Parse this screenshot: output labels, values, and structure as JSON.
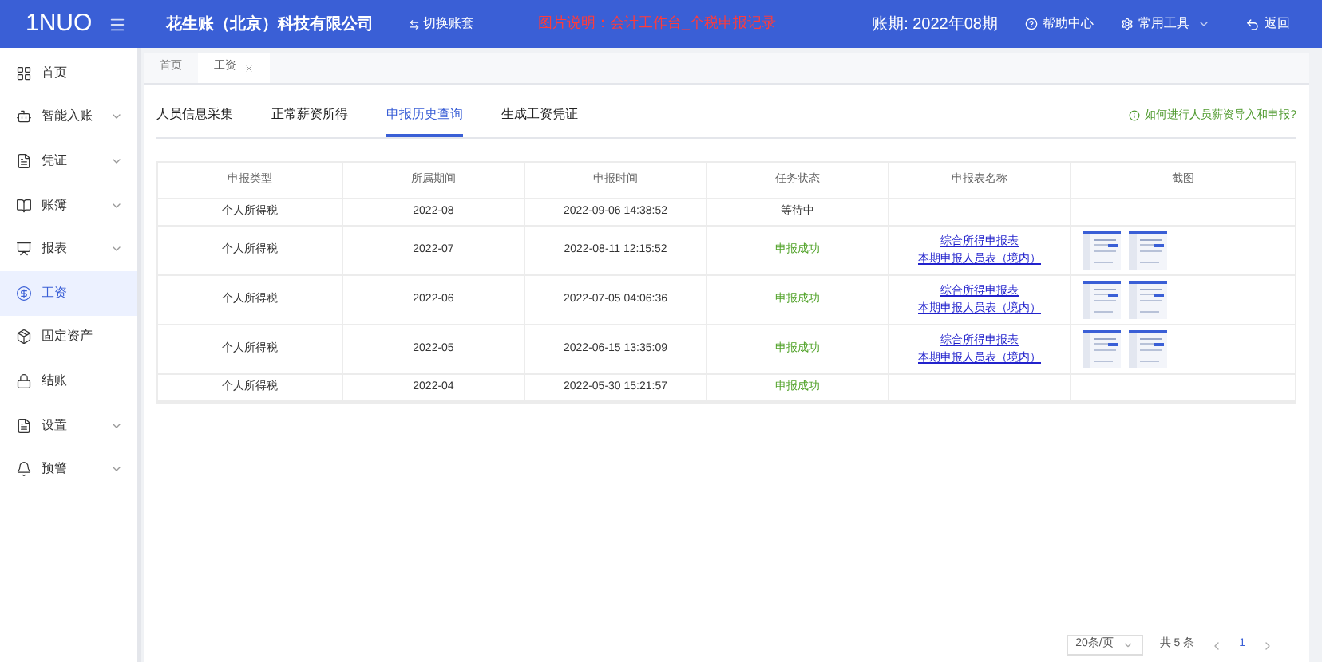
{
  "header": {
    "logo": "1NUO",
    "company": "花生账（北京）科技有限公司",
    "switch_account": "切换账套",
    "notice": "图片说明：会计工作台_个税申报记录",
    "period": "账期: 2022年08期",
    "help": "帮助中心",
    "tools": "常用工具",
    "back": "返回"
  },
  "sidebar": {
    "items": [
      {
        "label": "首页",
        "expandable": false,
        "selected": false
      },
      {
        "label": "智能入账",
        "expandable": true,
        "selected": false
      },
      {
        "label": "凭证",
        "expandable": true,
        "selected": false
      },
      {
        "label": "账簿",
        "expandable": true,
        "selected": false
      },
      {
        "label": "报表",
        "expandable": true,
        "selected": false
      },
      {
        "label": "工资",
        "expandable": false,
        "selected": true
      },
      {
        "label": "固定资产",
        "expandable": false,
        "selected": false
      },
      {
        "label": "结账",
        "expandable": false,
        "selected": false
      },
      {
        "label": "设置",
        "expandable": true,
        "selected": false
      },
      {
        "label": "预警",
        "expandable": true,
        "selected": false
      }
    ]
  },
  "page_tabs": [
    {
      "label": "首页",
      "selected": false,
      "closable": false
    },
    {
      "label": "工资",
      "selected": true,
      "closable": true
    }
  ],
  "sub_tabs": [
    {
      "label": "人员信息采集",
      "selected": false
    },
    {
      "label": "正常薪资所得",
      "selected": false
    },
    {
      "label": "申报历史查询",
      "selected": true
    },
    {
      "label": "生成工资凭证",
      "selected": false
    }
  ],
  "help_link": "如何进行人员薪资导入和申报?",
  "table": {
    "columns": [
      "申报类型",
      "所属期间",
      "申报时间",
      "任务状态",
      "申报表名称",
      "截图"
    ],
    "rows": [
      {
        "type": "个人所得税",
        "period": "2022-08",
        "time": "2022-09-06 14:38:52",
        "status": {
          "text": "等待中",
          "kind": "waiting"
        },
        "reports": [],
        "has_screenshots": false
      },
      {
        "type": "个人所得税",
        "period": "2022-07",
        "time": "2022-08-11 12:15:52",
        "status": {
          "text": "申报成功",
          "kind": "success"
        },
        "reports": [
          "综合所得申报表",
          "本期申报人员表（境内）"
        ],
        "has_screenshots": true
      },
      {
        "type": "个人所得税",
        "period": "2022-06",
        "time": "2022-07-05 04:06:36",
        "status": {
          "text": "申报成功",
          "kind": "success"
        },
        "reports": [
          "综合所得申报表",
          "本期申报人员表（境内）"
        ],
        "has_screenshots": true
      },
      {
        "type": "个人所得税",
        "period": "2022-05",
        "time": "2022-06-15 13:35:09",
        "status": {
          "text": "申报成功",
          "kind": "success"
        },
        "reports": [
          "综合所得申报表",
          "本期申报人员表（境内）"
        ],
        "has_screenshots": true
      },
      {
        "type": "个人所得税",
        "period": "2022-04",
        "time": "2022-05-30 15:21:57",
        "status": {
          "text": "申报成功",
          "kind": "success"
        },
        "reports": [],
        "has_screenshots": false
      }
    ]
  },
  "pagination": {
    "page_size": "20条/页",
    "total": "共 5 条",
    "pages": [
      {
        "label": "1",
        "selected": true
      }
    ]
  }
}
